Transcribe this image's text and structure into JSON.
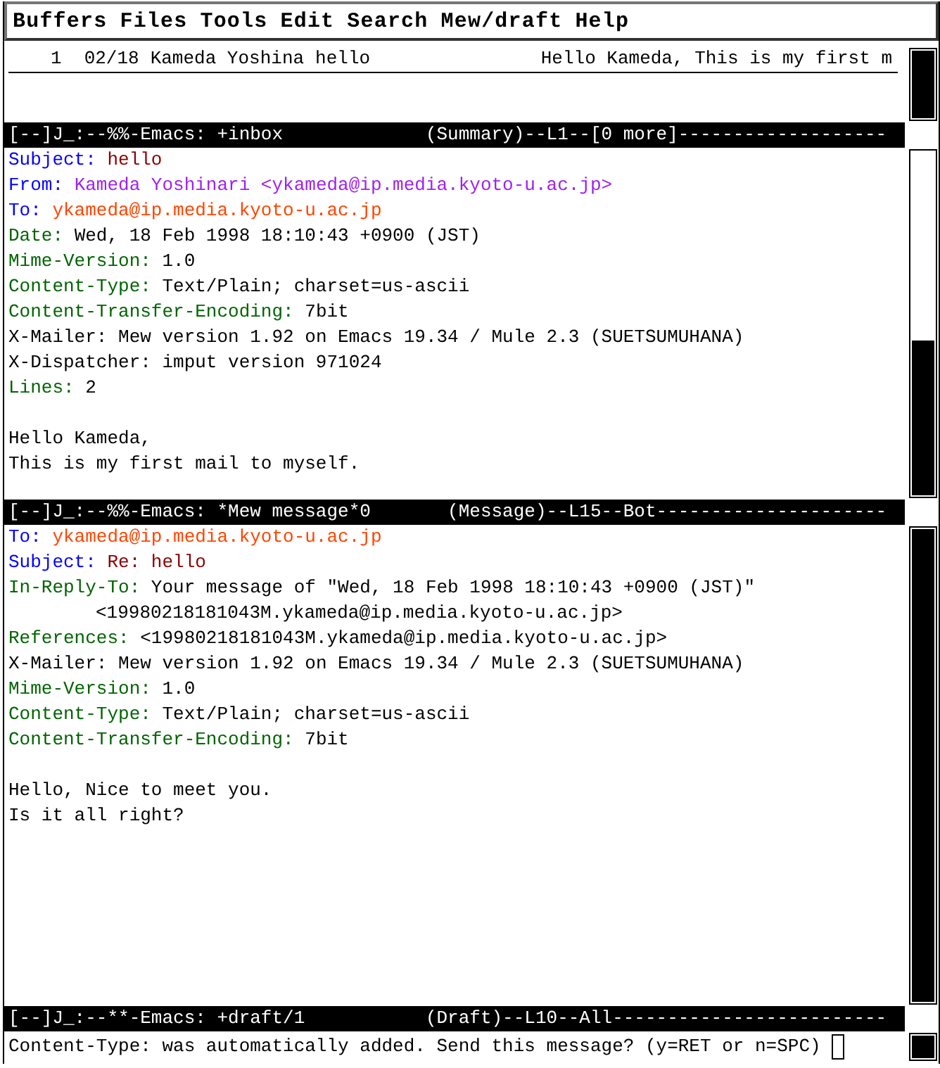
{
  "menu_bar": [
    "Buffers",
    "Files",
    "Tools",
    "Edit",
    "Search",
    "Mew/draft",
    "Help"
  ],
  "summary_window": {
    "rows": [
      {
        "number": "1",
        "date": "02/18",
        "sender": "Kameda Yoshina",
        "subject": "hello",
        "preview": "Hello Kameda, This is my first m",
        "selected": true
      }
    ],
    "mode_line": "[--]J_:--%%-Emacs: +inbox             (Summary)--L1--[0 more]-------------------"
  },
  "message_window": {
    "headers": [
      {
        "kind": "subject",
        "name": "Subject:",
        "value": "hello"
      },
      {
        "kind": "from",
        "name": "From:",
        "value": "Kameda Yoshinari <ykameda@ip.media.kyoto-u.ac.jp>"
      },
      {
        "kind": "to",
        "name": "To:",
        "value": "ykameda@ip.media.kyoto-u.ac.jp"
      },
      {
        "kind": "field",
        "name": "Date:",
        "value": "Wed, 18 Feb 1998 18:10:43 +0900 (JST)"
      },
      {
        "kind": "field",
        "name": "Mime-Version:",
        "value": "1.0"
      },
      {
        "kind": "field",
        "name": "Content-Type:",
        "value": "Text/Plain; charset=us-ascii"
      },
      {
        "kind": "field",
        "name": "Content-Transfer-Encoding:",
        "value": "7bit"
      },
      {
        "kind": "plain",
        "name": "X-Mailer:",
        "value": "Mew version 1.92 on Emacs 19.34 / Mule 2.3 (SUETSUMUHANA)"
      },
      {
        "kind": "plain",
        "name": "X-Dispatcher:",
        "value": "imput version 971024"
      },
      {
        "kind": "field",
        "name": "Lines:",
        "value": "2"
      }
    ],
    "body": [
      "Hello Kameda,",
      "This is my first mail to myself."
    ],
    "mode_line": "[--]J_:--%%-Emacs: *Mew message*0       (Message)--L15--Bot---------------------"
  },
  "draft_window": {
    "headers": [
      {
        "kind": "to",
        "name": "To:",
        "value": "ykameda@ip.media.kyoto-u.ac.jp"
      },
      {
        "kind": "subject",
        "name": "Subject:",
        "value": "Re: hello"
      },
      {
        "kind": "field",
        "name": "In-Reply-To:",
        "value": "Your message of \"Wed, 18 Feb 1998 18:10:43 +0900 (JST)\""
      },
      {
        "kind": "continuation",
        "value": "<19980218181043M.ykameda@ip.media.kyoto-u.ac.jp>"
      },
      {
        "kind": "field",
        "name": "References:",
        "value": "<19980218181043M.ykameda@ip.media.kyoto-u.ac.jp>"
      },
      {
        "kind": "plain",
        "name": "X-Mailer:",
        "value": "Mew version 1.92 on Emacs 19.34 / Mule 2.3 (SUETSUMUHANA)"
      },
      {
        "kind": "field",
        "name": "Mime-Version:",
        "value": "1.0"
      },
      {
        "kind": "field",
        "name": "Content-Type:",
        "value": "Text/Plain; charset=us-ascii"
      },
      {
        "kind": "field",
        "name": "Content-Transfer-Encoding:",
        "value": "7bit"
      }
    ],
    "body": [
      "Hello, Nice to meet you.",
      "Is it all right?"
    ],
    "mode_line": "[--]J_:--**-Emacs: +draft/1           (Draft)--L10--All-------------------------"
  },
  "minibuffer": {
    "prompt": "Content-Type: was automatically added. Send this message? (y=RET or n=SPC)"
  }
}
